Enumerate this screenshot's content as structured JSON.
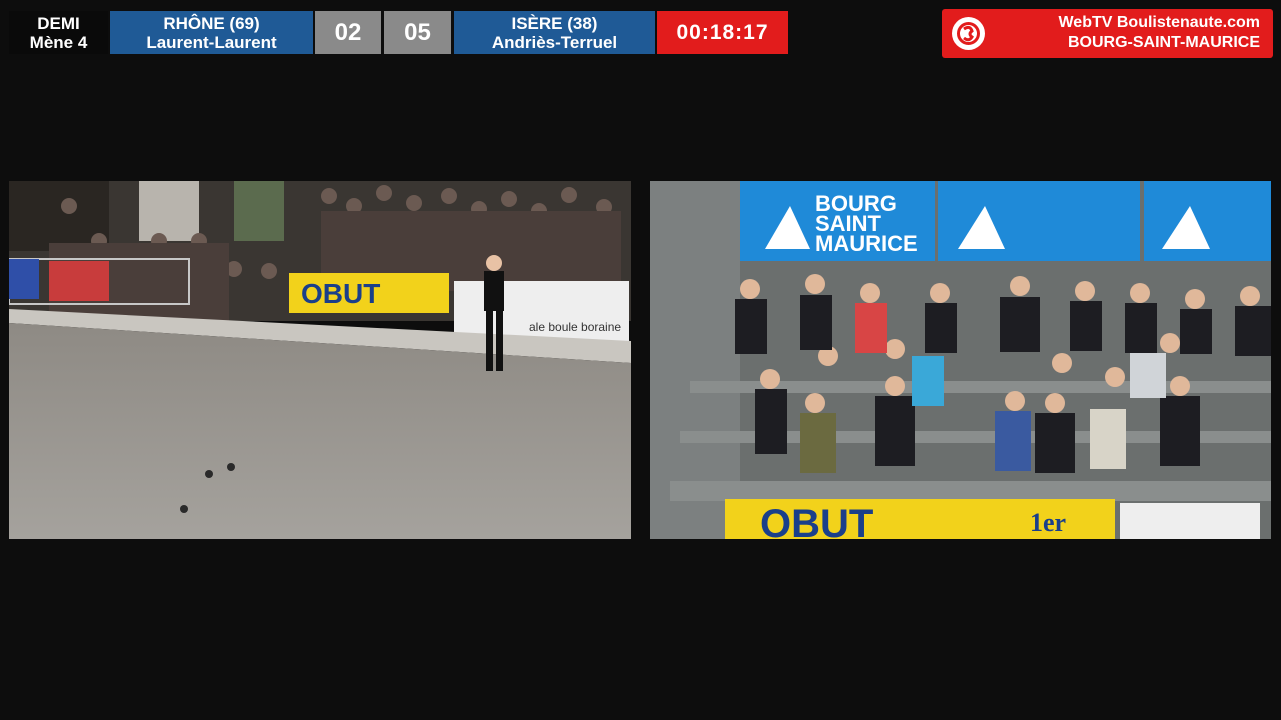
{
  "scoreboard": {
    "phase": "DEMI",
    "round": "Mène 4",
    "team1": {
      "name": "RHÔNE (69)",
      "players": "Laurent-Laurent",
      "score": "02"
    },
    "team2": {
      "name": "ISÈRE (38)",
      "players": "Andriès-Terruel",
      "score": "05"
    },
    "clock": "00:18:17"
  },
  "broadcaster": {
    "line1": "WebTV Boulistenaute.com",
    "line2": "BOURG-SAINT-MAURICE"
  },
  "left_feed": {
    "banner_sponsor": "OBUT",
    "banner_text": "ale boule boraine"
  },
  "right_feed": {
    "banner_line1": "BOURG",
    "banner_line2": "SAINT",
    "banner_line3": "MAURICE",
    "sponsor": "OBUT",
    "sponsor_rank": "1er"
  },
  "colors": {
    "team_blue": "#1f5a96",
    "score_grey": "#8a8a8a",
    "accent_red": "#e21c1c",
    "banner_blue": "#1f8ad8",
    "obut_yellow": "#f2d21b"
  }
}
